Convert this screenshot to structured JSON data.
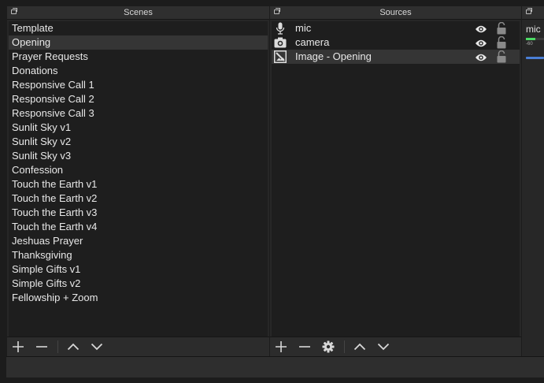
{
  "scenes": {
    "title": "Scenes",
    "items": [
      {
        "label": "Template",
        "selected": false
      },
      {
        "label": "Opening",
        "selected": true
      },
      {
        "label": "Prayer Requests",
        "selected": false
      },
      {
        "label": "Donations",
        "selected": false
      },
      {
        "label": "Responsive Call 1",
        "selected": false
      },
      {
        "label": "Responsive Call 2",
        "selected": false
      },
      {
        "label": "Responsive Call 3",
        "selected": false
      },
      {
        "label": "Sunlit Sky v1",
        "selected": false
      },
      {
        "label": "Sunlit Sky v2",
        "selected": false
      },
      {
        "label": "Sunlit Sky v3",
        "selected": false
      },
      {
        "label": "Confession",
        "selected": false
      },
      {
        "label": "Touch the Earth v1",
        "selected": false
      },
      {
        "label": "Touch the Earth v2",
        "selected": false
      },
      {
        "label": "Touch the Earth v3",
        "selected": false
      },
      {
        "label": "Touch the Earth v4",
        "selected": false
      },
      {
        "label": "Jeshuas Prayer",
        "selected": false
      },
      {
        "label": "Thanksgiving",
        "selected": false
      },
      {
        "label": "Simple Gifts v1",
        "selected": false
      },
      {
        "label": "Simple Gifts v2",
        "selected": false
      },
      {
        "label": "Fellowship + Zoom",
        "selected": false
      }
    ],
    "toolbar": [
      "add-icon",
      "remove-icon",
      "move-up-icon",
      "move-down-icon"
    ]
  },
  "sources": {
    "title": "Sources",
    "items": [
      {
        "label": "mic",
        "icon": "microphone-icon",
        "visible": true,
        "locked": false,
        "selected": false
      },
      {
        "label": "camera",
        "icon": "camera-icon",
        "visible": true,
        "locked": false,
        "selected": false
      },
      {
        "label": "Image - Opening",
        "icon": "image-icon",
        "visible": true,
        "locked": false,
        "selected": true
      }
    ],
    "toolbar": [
      "add-icon",
      "remove-icon",
      "gear-icon",
      "move-up-icon",
      "move-down-icon"
    ]
  },
  "mixer": {
    "track_label": "mic",
    "scale_label": "-60",
    "colors": {
      "meter_green": "#4cd964",
      "volume_blue": "#4a7fd6"
    }
  },
  "colors": {
    "panel_bg": "#272727",
    "list_bg": "#1e1e1e",
    "selected_row": "#353535",
    "text": "#e8e8e8"
  }
}
